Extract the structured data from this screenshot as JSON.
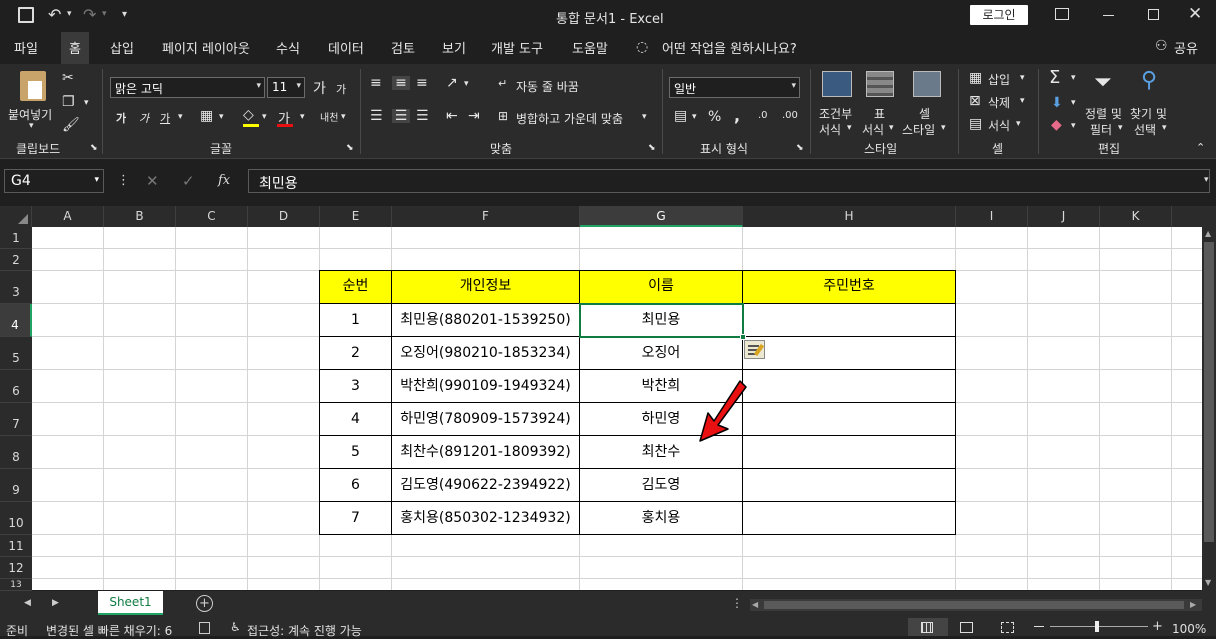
{
  "titlebar": {
    "title": "통합 문서1  -  Excel",
    "login_label": "로그인"
  },
  "menu": {
    "items": [
      "파일",
      "홈",
      "삽입",
      "페이지 레이아웃",
      "수식",
      "데이터",
      "검토",
      "보기",
      "개발 도구",
      "도움말"
    ],
    "tell_me": "어떤 작업을 원하시나요?",
    "share": "공유"
  },
  "ribbon": {
    "clipboard": {
      "paste": "붙여넣기",
      "label": "클립보드"
    },
    "font": {
      "name": "맑은 고딕",
      "size": "11",
      "label": "글꼴",
      "bold": "가",
      "italic": "가",
      "underline": "가",
      "grow": "가",
      "shrink": "가",
      "phonetic": "내천"
    },
    "alignment": {
      "wrap": "자동 줄 바꿈",
      "merge": "병합하고 가운데 맞춤",
      "label": "맞춤"
    },
    "number": {
      "format": "일반",
      "percent": "%",
      "comma": ",",
      "label": "표시 형식"
    },
    "styles": {
      "conditional": "조건부\n서식",
      "cond1": "조건부",
      "cond2": "서식",
      "table1": "표",
      "table2": "서식",
      "cell1": "셀",
      "cell2": "스타일",
      "label": "스타일"
    },
    "cells": {
      "insert": "삽입",
      "delete": "삭제",
      "format": "서식",
      "label": "셀"
    },
    "editing": {
      "sort1": "정렬 및",
      "sort2": "필터",
      "find1": "찾기 및",
      "find2": "선택",
      "label": "편집"
    }
  },
  "formula": {
    "name_box": "G4",
    "value": "최민용",
    "fx": "fx"
  },
  "columns": [
    "A",
    "B",
    "C",
    "D",
    "E",
    "F",
    "G",
    "H",
    "I",
    "J",
    "K"
  ],
  "rows": [
    "1",
    "2",
    "3",
    "4",
    "5",
    "6",
    "7",
    "8",
    "9",
    "10",
    "11",
    "12",
    "13"
  ],
  "table": {
    "headers": [
      "순번",
      "개인정보",
      "이름",
      "주민번호"
    ],
    "rows": [
      [
        "1",
        "최민용(880201-1539250)",
        "최민용",
        ""
      ],
      [
        "2",
        "오징어(980210-1853234)",
        "오징어",
        ""
      ],
      [
        "3",
        "박찬희(990109-1949324)",
        "박찬희",
        ""
      ],
      [
        "4",
        "하민영(780909-1573924)",
        "하민영",
        ""
      ],
      [
        "5",
        "최찬수(891201-1809392)",
        "최찬수",
        ""
      ],
      [
        "6",
        "김도영(490622-2394922)",
        "김도영",
        ""
      ],
      [
        "7",
        "홍치용(850302-1234932)",
        "홍치용",
        ""
      ]
    ]
  },
  "sheet": {
    "tab": "Sheet1"
  },
  "status": {
    "mode": "준비",
    "flash_fill": "변경된 셀 빠른 채우기: 6",
    "accessibility": "접근성: 계속 진행 가능",
    "zoom": "100%"
  },
  "colors": {
    "header_fill": "#ffff00",
    "accent": "#21a366",
    "arrow": "#e81010"
  }
}
